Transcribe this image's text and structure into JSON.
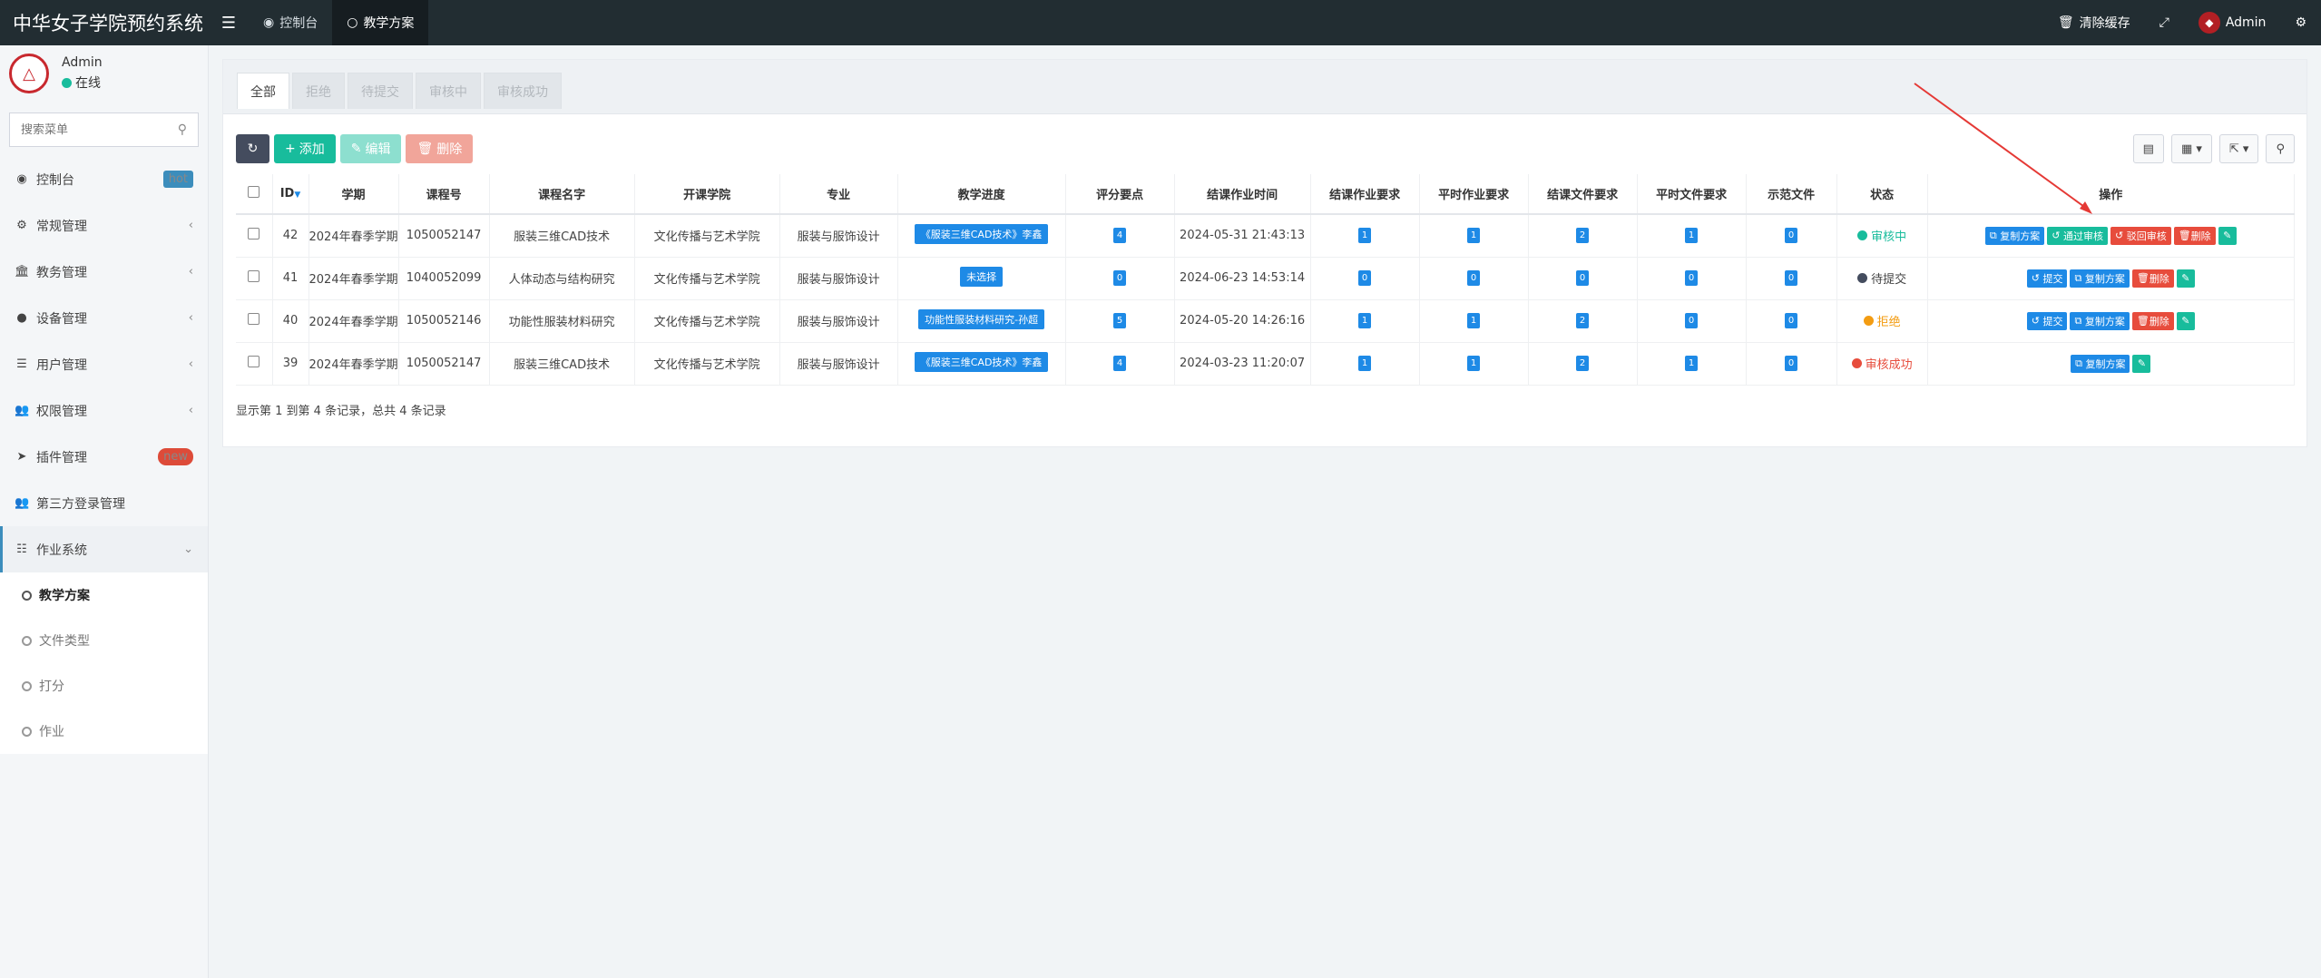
{
  "header": {
    "brand": "中华女子学院预约系统",
    "tabs": [
      {
        "label": "控制台",
        "icon": "dashboard-icon"
      },
      {
        "label": "教学方案",
        "icon": "circle-icon"
      }
    ],
    "clear_cache": "清除缓存",
    "user": "Admin"
  },
  "sidebar": {
    "user_name": "Admin",
    "user_status": "在线",
    "search_placeholder": "搜索菜单",
    "items": [
      {
        "label": "控制台",
        "badge": "hot"
      },
      {
        "label": "常规管理"
      },
      {
        "label": "教务管理"
      },
      {
        "label": "设备管理"
      },
      {
        "label": "用户管理"
      },
      {
        "label": "权限管理"
      },
      {
        "label": "插件管理",
        "badge": "new"
      },
      {
        "label": "第三方登录管理"
      },
      {
        "label": "作业系统"
      }
    ],
    "subitems": [
      {
        "label": "教学方案"
      },
      {
        "label": "文件类型"
      },
      {
        "label": "打分"
      },
      {
        "label": "作业"
      }
    ]
  },
  "tabs": [
    "全部",
    "拒绝",
    "待提交",
    "审核中",
    "审核成功"
  ],
  "toolbar": {
    "add": "添加",
    "edit": "编辑",
    "delete": "删除"
  },
  "table": {
    "headers": [
      "ID",
      "学期",
      "课程号",
      "课程名字",
      "开课学院",
      "专业",
      "教学进度",
      "评分要点",
      "结课作业时间",
      "结课作业要求",
      "平时作业要求",
      "结课文件要求",
      "平时文件要求",
      "示范文件",
      "状态",
      "操作"
    ],
    "rows": [
      {
        "id": "42",
        "term": "2024年春季学期",
        "code": "1050052147",
        "name": "服装三维CAD技术",
        "college": "文化传播与艺术学院",
        "major": "服装与服饰设计",
        "progress": "《服装三维CAD技术》李鑫",
        "points": "4",
        "time": "2024-05-31 21:43:13",
        "final_req": "1",
        "usual_req": "1",
        "final_file": "2",
        "usual_file": "1",
        "demo": "0",
        "status": "审核中",
        "status_color": "#18bc9c",
        "ops": [
          "复制方案",
          "通过审核",
          "驳回审核",
          "删除"
        ]
      },
      {
        "id": "41",
        "term": "2024年春季学期",
        "code": "1040052099",
        "name": "人体动态与结构研究",
        "college": "文化传播与艺术学院",
        "major": "服装与服饰设计",
        "progress": "未选择",
        "points": "0",
        "time": "2024-06-23 14:53:14",
        "final_req": "0",
        "usual_req": "0",
        "final_file": "0",
        "usual_file": "0",
        "demo": "0",
        "status": "待提交",
        "status_color": "#444c5e",
        "ops": [
          "提交",
          "复制方案",
          "删除"
        ]
      },
      {
        "id": "40",
        "term": "2024年春季学期",
        "code": "1050052146",
        "name": "功能性服装材料研究",
        "college": "文化传播与艺术学院",
        "major": "服装与服饰设计",
        "progress": "功能性服装材料研究-孙超",
        "points": "5",
        "time": "2024-05-20 14:26:16",
        "final_req": "1",
        "usual_req": "1",
        "final_file": "2",
        "usual_file": "0",
        "demo": "0",
        "status": "拒绝",
        "status_color": "#f39c12",
        "ops": [
          "提交",
          "复制方案",
          "删除"
        ]
      },
      {
        "id": "39",
        "term": "2024年春季学期",
        "code": "1050052147",
        "name": "服装三维CAD技术",
        "college": "文化传播与艺术学院",
        "major": "服装与服饰设计",
        "progress": "《服装三维CAD技术》李鑫",
        "points": "4",
        "time": "2024-03-23 11:20:07",
        "final_req": "1",
        "usual_req": "1",
        "final_file": "2",
        "usual_file": "1",
        "demo": "0",
        "status": "审核成功",
        "status_color": "#e74c3c",
        "ops": [
          "复制方案"
        ]
      }
    ]
  },
  "footer_text": "显示第 1 到第 4 条记录，总共 4 条记录",
  "colors": {
    "accent": "#1e8ae6",
    "success": "#18bc9c",
    "danger": "#e74c3c",
    "header": "#222d32"
  }
}
